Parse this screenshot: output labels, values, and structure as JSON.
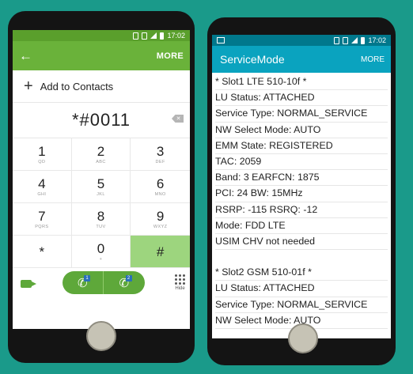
{
  "dialer": {
    "status_time": "17:02",
    "more_label": "MORE",
    "add_to_contacts": "Add to Contacts",
    "dialed_number": "*#0011",
    "backspace_symbol": "✕",
    "keys": [
      {
        "digit": "1",
        "sub": "QD"
      },
      {
        "digit": "2",
        "sub": "ABC"
      },
      {
        "digit": "3",
        "sub": "DEF"
      },
      {
        "digit": "4",
        "sub": "GHI"
      },
      {
        "digit": "5",
        "sub": "JKL"
      },
      {
        "digit": "6",
        "sub": "MNO"
      },
      {
        "digit": "7",
        "sub": "PQRS"
      },
      {
        "digit": "8",
        "sub": "TUV"
      },
      {
        "digit": "9",
        "sub": "WXYZ"
      },
      {
        "digit": "*",
        "sub": ""
      },
      {
        "digit": "0",
        "sub": "+"
      },
      {
        "digit": "#",
        "sub": ""
      }
    ],
    "sim1_badge": "1",
    "sim2_badge": "2",
    "hide_label": "Hide",
    "colors": {
      "header": "#6ab23a",
      "statusbar": "#5a9f2c",
      "active_key": "#9dd57e",
      "call": "#5ea83a"
    }
  },
  "service": {
    "status_time": "17:02",
    "title": "ServiceMode",
    "more_label": "MORE",
    "lines": [
      "* Slot1 LTE 510-10f *",
      "LU Status: ATTACHED",
      "Service Type: NORMAL_SERVICE",
      "NW Select Mode: AUTO",
      "EMM State: REGISTERED",
      "TAC: 2059",
      "Band: 3  EARFCN: 1875",
      "PCI: 24  BW: 15MHz",
      "RSRP: -115  RSRQ: -12",
      "Mode: FDD LTE",
      "USIM CHV not needed",
      "",
      "* Slot2 GSM 510-01f *",
      "LU Status: ATTACHED",
      "Service Type: NORMAL_SERVICE",
      "NW Select Mode: AUTO"
    ],
    "colors": {
      "header": "#0aa3bf",
      "statusbar": "#00788c"
    }
  }
}
